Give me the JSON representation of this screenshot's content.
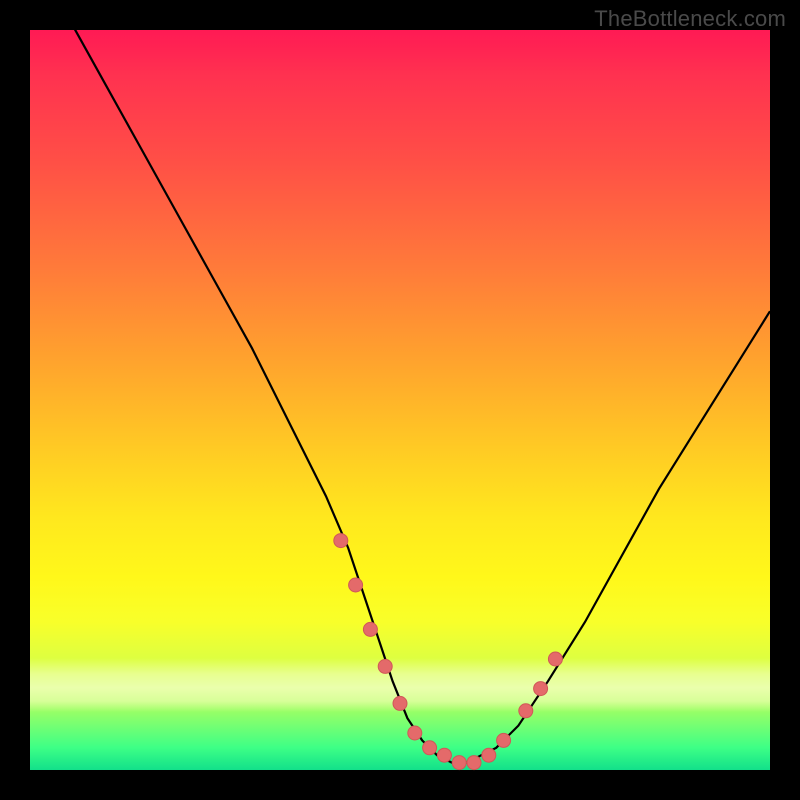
{
  "watermark": "TheBottleneck.com",
  "colors": {
    "frame_bg": "#000000",
    "curve_stroke": "#000000",
    "marker_fill": "#e46a6a",
    "marker_stroke": "#d05858"
  },
  "chart_data": {
    "type": "line",
    "title": "",
    "xlabel": "",
    "ylabel": "",
    "xlim": [
      0,
      100
    ],
    "ylim": [
      0,
      100
    ],
    "grid": false,
    "legend": false,
    "series": [
      {
        "name": "bottleneck-curve",
        "x": [
          5,
          10,
          15,
          20,
          25,
          30,
          35,
          40,
          43,
          45,
          47,
          49,
          51,
          53,
          55,
          57,
          59,
          61,
          63,
          66,
          70,
          75,
          80,
          85,
          90,
          95,
          100
        ],
        "values": [
          102,
          93,
          84,
          75,
          66,
          57,
          47,
          37,
          30,
          24,
          18,
          12,
          7,
          4,
          2,
          1,
          1,
          2,
          3,
          6,
          12,
          20,
          29,
          38,
          46,
          54,
          62
        ]
      }
    ],
    "markers": {
      "name": "highlighted-points",
      "x": [
        42,
        44,
        46,
        48,
        50,
        52,
        54,
        56,
        58,
        60,
        62,
        64,
        67,
        69,
        71
      ],
      "values": [
        31,
        25,
        19,
        14,
        9,
        5,
        3,
        2,
        1,
        1,
        2,
        4,
        8,
        11,
        15
      ]
    }
  }
}
